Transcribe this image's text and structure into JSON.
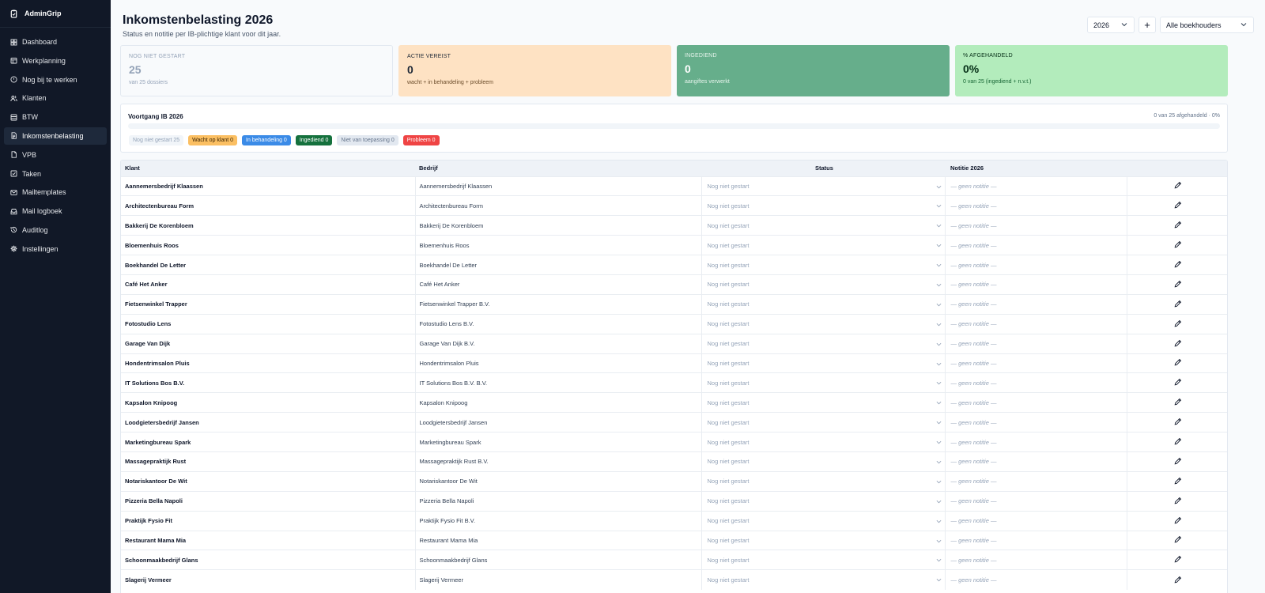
{
  "app": {
    "name": "AdminGrip"
  },
  "sidebar": {
    "items": [
      {
        "label": "Dashboard",
        "icon": "dashboard-icon"
      },
      {
        "label": "Werkplanning",
        "icon": "planning-icon"
      },
      {
        "label": "Nog bij te werken",
        "icon": "alert-circle-icon"
      },
      {
        "label": "Klanten",
        "icon": "users-icon"
      },
      {
        "label": "BTW",
        "icon": "receipt-icon"
      },
      {
        "label": "Inkomstenbelasting",
        "icon": "document-icon"
      },
      {
        "label": "VPB",
        "icon": "file-icon"
      },
      {
        "label": "Taken",
        "icon": "check-square-icon"
      },
      {
        "label": "Mailtemplates",
        "icon": "mail-icon"
      },
      {
        "label": "Mail logboek",
        "icon": "inbox-icon"
      },
      {
        "label": "Auditlog",
        "icon": "history-icon"
      },
      {
        "label": "Instellingen",
        "icon": "gear-icon"
      }
    ],
    "active_index": 5
  },
  "header": {
    "title": "Inkomstenbelasting 2026",
    "subtitle": "Status en notitie per IB-plichtige klant voor dit jaar.",
    "year": "2026",
    "plus": "+",
    "accountant_filter": "Alle boekhouders"
  },
  "stats": [
    {
      "label": "Nog niet gestart",
      "value": "25",
      "sub": "van 25 dossiers"
    },
    {
      "label": "Actie vereist",
      "value": "0",
      "sub": "wacht + in behandeling + probleem"
    },
    {
      "label": "Ingediend",
      "value": "0",
      "sub": "aangiftes verwerkt"
    },
    {
      "label": "% Afgehandeld",
      "value": "0%",
      "sub": "0 van 25 (ingediend + n.v.t.)"
    }
  ],
  "progress": {
    "title": "Voortgang IB 2026",
    "summary": "0 van 25 afgehandeld · 0%",
    "fraction": 0,
    "badges": [
      {
        "label": "Nog niet gestart 25",
        "kind": "b-ns"
      },
      {
        "label": "Wacht op klant 0",
        "kind": "b-wait"
      },
      {
        "label": "In behandeling 0",
        "kind": "b-beh"
      },
      {
        "label": "Ingediend 0",
        "kind": "b-ing"
      },
      {
        "label": "Niet van toepassing 0",
        "kind": "b-nvt"
      },
      {
        "label": "Probleem 0",
        "kind": "b-prob"
      }
    ]
  },
  "table": {
    "headers": {
      "klant": "Klant",
      "bedrijf": "Bedrijf",
      "status": "Status",
      "notitie": "Notitie 2026"
    },
    "status_default": "Nog niet gestart",
    "note_placeholder": "— geen notitie —",
    "rows": [
      {
        "klant": "Aannemersbedrijf Klaassen",
        "bedrijf": "Aannemersbedrijf Klaassen"
      },
      {
        "klant": "Architectenbureau Form",
        "bedrijf": "Architectenbureau Form"
      },
      {
        "klant": "Bakkerij De Korenbloem",
        "bedrijf": "Bakkerij De Korenbloem"
      },
      {
        "klant": "Bloemenhuis Roos",
        "bedrijf": "Bloemenhuis Roos"
      },
      {
        "klant": "Boekhandel De Letter",
        "bedrijf": "Boekhandel De Letter"
      },
      {
        "klant": "Café Het Anker",
        "bedrijf": "Café Het Anker"
      },
      {
        "klant": "Fietsenwinkel Trapper",
        "bedrijf": "Fietsenwinkel Trapper B.V."
      },
      {
        "klant": "Fotostudio Lens",
        "bedrijf": "Fotostudio Lens B.V."
      },
      {
        "klant": "Garage Van Dijk",
        "bedrijf": "Garage Van Dijk B.V."
      },
      {
        "klant": "Hondentrimsalon Pluis",
        "bedrijf": "Hondentrimsalon Pluis"
      },
      {
        "klant": "IT Solutions Bos B.V.",
        "bedrijf": "IT Solutions Bos B.V. B.V."
      },
      {
        "klant": "Kapsalon Knipoog",
        "bedrijf": "Kapsalon Knipoog"
      },
      {
        "klant": "Loodgietersbedrijf Jansen",
        "bedrijf": "Loodgietersbedrijf Jansen"
      },
      {
        "klant": "Marketingbureau Spark",
        "bedrijf": "Marketingbureau Spark"
      },
      {
        "klant": "Massagepraktijk Rust",
        "bedrijf": "Massagepraktijk Rust B.V."
      },
      {
        "klant": "Notariskantoor De Wit",
        "bedrijf": "Notariskantoor De Wit"
      },
      {
        "klant": "Pizzeria Bella Napoli",
        "bedrijf": "Pizzeria Bella Napoli"
      },
      {
        "klant": "Praktijk Fysio Fit",
        "bedrijf": "Praktijk Fysio Fit B.V."
      },
      {
        "klant": "Restaurant Mama Mia",
        "bedrijf": "Restaurant Mama Mia"
      },
      {
        "klant": "Schoonmaakbedrijf Glans",
        "bedrijf": "Schoonmaakbedrijf Glans"
      },
      {
        "klant": "Slagerij Vermeer",
        "bedrijf": "Slagerij Vermeer"
      }
    ]
  }
}
